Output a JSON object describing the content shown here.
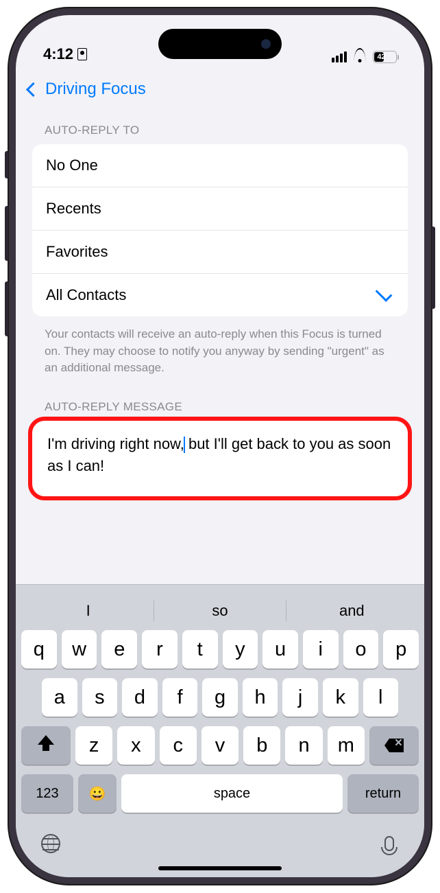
{
  "status": {
    "time": "4:12",
    "battery": "42"
  },
  "nav": {
    "back": "Driving Focus"
  },
  "section1": {
    "header": "AUTO-REPLY TO",
    "rows": [
      "No One",
      "Recents",
      "Favorites",
      "All Contacts"
    ],
    "selected": 3,
    "footer": "Your contacts will receive an auto-reply when this Focus is turned on. They may choose to notify you anyway by sending \"urgent\" as an additional message."
  },
  "section2": {
    "header": "AUTO-REPLY MESSAGE",
    "pre": "I'm driving right now,",
    "post": " but I'll get back to you as soon as I can!"
  },
  "keyboard": {
    "sug": [
      "I",
      "so",
      "and"
    ],
    "r1": [
      "q",
      "w",
      "e",
      "r",
      "t",
      "y",
      "u",
      "i",
      "o",
      "p"
    ],
    "r2": [
      "a",
      "s",
      "d",
      "f",
      "g",
      "h",
      "j",
      "k",
      "l"
    ],
    "r3": [
      "z",
      "x",
      "c",
      "v",
      "b",
      "n",
      "m"
    ],
    "n": "123",
    "space": "space",
    "ret": "return",
    "emoji": "😀"
  }
}
